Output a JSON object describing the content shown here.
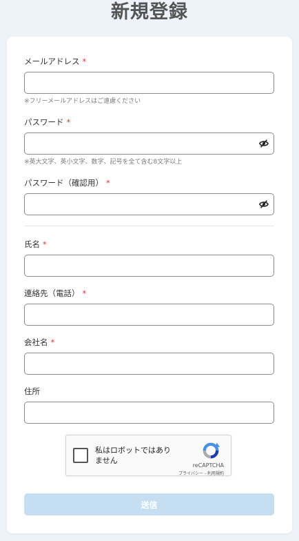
{
  "page": {
    "title": "新規登録"
  },
  "form": {
    "required_mark": "*",
    "email": {
      "label": "メールアドレス",
      "value": "",
      "hint": "※フリーメールアドレスはご遠慮ください"
    },
    "password": {
      "label": "パスワード",
      "value": "",
      "hint": "※英大文字、英小文字、数字、記号を全て含む8文字以上",
      "toggle_icon": "eye-slash-icon"
    },
    "password_confirm": {
      "label": "パスワード（確認用）",
      "value": "",
      "toggle_icon": "eye-slash-icon"
    },
    "name": {
      "label": "氏名",
      "value": ""
    },
    "phone": {
      "label": "連絡先（電話）",
      "value": ""
    },
    "company": {
      "label": "会社名",
      "value": ""
    },
    "address": {
      "label": "住所",
      "value": ""
    },
    "submit_label": "送信",
    "submit_enabled": false
  },
  "recaptcha": {
    "checkbox_label": "私はロボットではありません",
    "checked": false,
    "brand": "reCAPTCHA",
    "privacy_link": "プライバシー",
    "separator": "-",
    "terms_link": "利用規約",
    "logo_icon": "recaptcha-logo-icon"
  },
  "colors": {
    "background": "#edf3f9",
    "title": "#555555",
    "required": "#d23c3c",
    "submit_disabled": "#c5def2"
  }
}
